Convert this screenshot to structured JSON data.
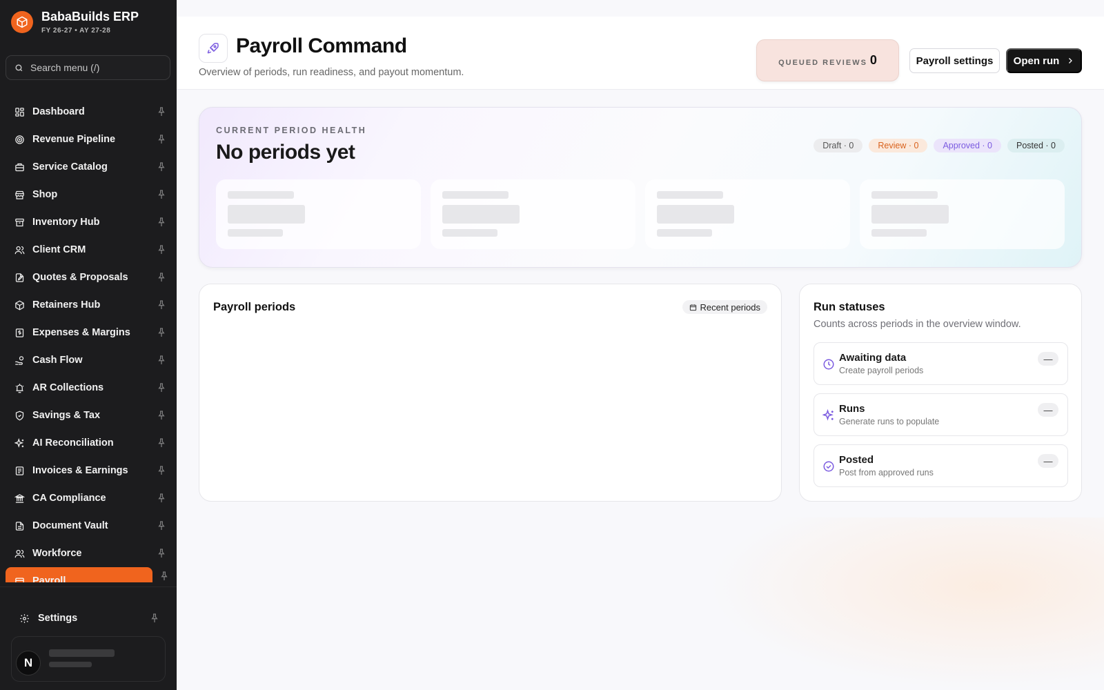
{
  "brand": {
    "name": "BabaBuilds ERP",
    "subtitle": "FY 26-27 • AY 27-28"
  },
  "search": {
    "placeholder": "Search menu (/)"
  },
  "nav": [
    {
      "label": "Dashboard",
      "icon": "dashboard-icon"
    },
    {
      "label": "Revenue Pipeline",
      "icon": "target-icon"
    },
    {
      "label": "Service Catalog",
      "icon": "briefcase-icon"
    },
    {
      "label": "Shop",
      "icon": "store-icon"
    },
    {
      "label": "Inventory Hub",
      "icon": "archive-icon"
    },
    {
      "label": "Client CRM",
      "icon": "users-icon"
    },
    {
      "label": "Quotes & Proposals",
      "icon": "file-edit-icon"
    },
    {
      "label": "Retainers Hub",
      "icon": "package-icon"
    },
    {
      "label": "Expenses & Margins",
      "icon": "receipt-icon"
    },
    {
      "label": "Cash Flow",
      "icon": "hand-coins-icon"
    },
    {
      "label": "AR Collections",
      "icon": "alarm-icon"
    },
    {
      "label": "Savings & Tax",
      "icon": "shield-icon"
    },
    {
      "label": "AI Reconciliation",
      "icon": "sparkles-icon"
    },
    {
      "label": "Invoices & Earnings",
      "icon": "invoice-icon"
    },
    {
      "label": "CA Compliance",
      "icon": "landmark-icon"
    },
    {
      "label": "Document Vault",
      "icon": "document-icon"
    },
    {
      "label": "Workforce",
      "icon": "user-icon"
    },
    {
      "label": "Payroll",
      "icon": "wallet-icon",
      "active": true
    }
  ],
  "settings": {
    "label": "Settings"
  },
  "user": {
    "initial": "N"
  },
  "header": {
    "title": "Payroll Command",
    "subtitle": "Overview of periods, run readiness, and payout momentum.",
    "queued_label": "QUEUED REVIEWS",
    "queued_value": "0",
    "settings_button": "Payroll settings",
    "open_run_button": "Open run"
  },
  "health": {
    "kicker": "CURRENT PERIOD HEALTH",
    "title": "No periods yet",
    "pills": {
      "draft": "Draft · 0",
      "review": "Review · 0",
      "approved": "Approved · 0",
      "posted": "Posted · 0"
    }
  },
  "periods": {
    "title": "Payroll periods",
    "badge": "Recent periods"
  },
  "statuses": {
    "title": "Run statuses",
    "subtitle": "Counts across periods in the overview window.",
    "rows": [
      {
        "title": "Awaiting data",
        "sub": "Create payroll periods",
        "value": "—",
        "icon": "clock-icon"
      },
      {
        "title": "Runs",
        "sub": "Generate runs to populate",
        "value": "—",
        "icon": "sparkles-icon"
      },
      {
        "title": "Posted",
        "sub": "Post from approved runs",
        "value": "—",
        "icon": "check-circle-icon"
      }
    ]
  },
  "colors": {
    "accent": "#f0641e",
    "sidebar": "#1c1c1e",
    "icon_purple": "#7b5be0"
  }
}
